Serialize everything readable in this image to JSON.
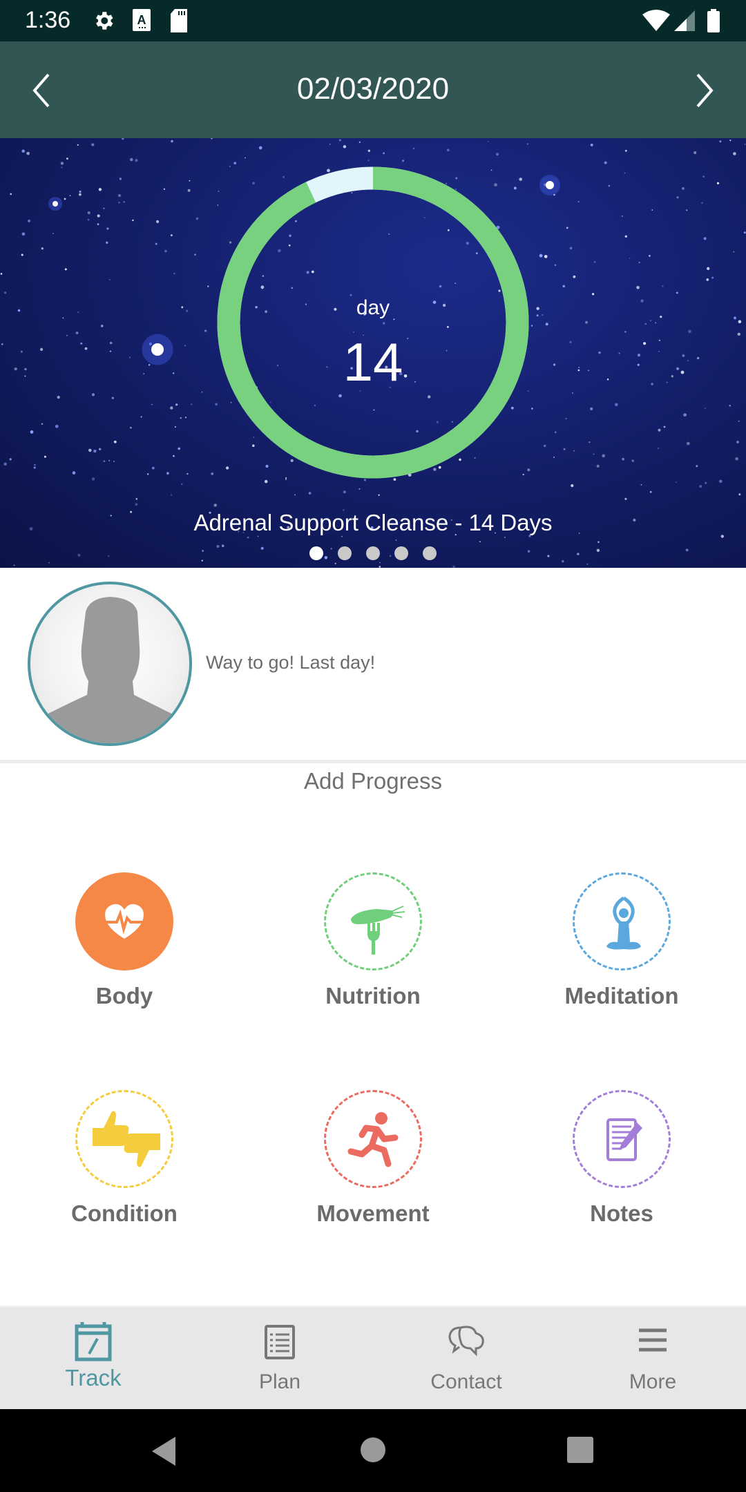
{
  "status_bar": {
    "time": "1:36",
    "icons": [
      "gear-icon",
      "text-a-icon",
      "sd-card-icon",
      "wifi-icon",
      "signal-icon",
      "battery-icon"
    ]
  },
  "header": {
    "date": "02/03/2020",
    "prev_icon": "chevron-left-icon",
    "next_icon": "chevron-right-icon"
  },
  "hero": {
    "day_label": "day",
    "day_value": "14",
    "progress": {
      "current_day": 14,
      "total_days": 14,
      "completed_fraction": 0.929
    },
    "ring_colors": {
      "completed": "#77d17e",
      "remaining": "#e1f5fb"
    },
    "program_title": "Adrenal Support Cleanse - 14 Days",
    "page_dots": {
      "count": 5,
      "active_index": 0
    }
  },
  "message": {
    "text": "Way to go! Last day!",
    "avatar_icon": "person-silhouette-icon"
  },
  "add_progress": {
    "title": "Add Progress",
    "items": [
      {
        "label": "Body",
        "icon": "heart-pulse-icon",
        "color": "#f58846",
        "style": "filled"
      },
      {
        "label": "Nutrition",
        "icon": "carrot-fork-icon",
        "color": "#6fcf7a",
        "style": "dashed"
      },
      {
        "label": "Meditation",
        "icon": "yoga-meditation-icon",
        "color": "#5aa8dd",
        "style": "dashed"
      },
      {
        "label": "Condition",
        "icon": "thumbs-up-down-icon",
        "color": "#f5cd3c",
        "style": "dashed"
      },
      {
        "label": "Movement",
        "icon": "running-person-icon",
        "color": "#ec6b60",
        "style": "dashed"
      },
      {
        "label": "Notes",
        "icon": "notepad-pencil-icon",
        "color": "#a37ed8",
        "style": "dashed"
      }
    ]
  },
  "bottom_nav": {
    "active_color": "#4e97a3",
    "items": [
      {
        "label": "Track",
        "icon": "calendar-edit-icon",
        "active": true
      },
      {
        "label": "Plan",
        "icon": "receipt-list-icon",
        "active": false
      },
      {
        "label": "Contact",
        "icon": "chat-bubbles-icon",
        "active": false
      },
      {
        "label": "More",
        "icon": "hamburger-menu-icon",
        "active": false
      }
    ]
  },
  "system_nav": {
    "buttons": [
      "back-icon",
      "home-icon",
      "recents-icon"
    ]
  }
}
